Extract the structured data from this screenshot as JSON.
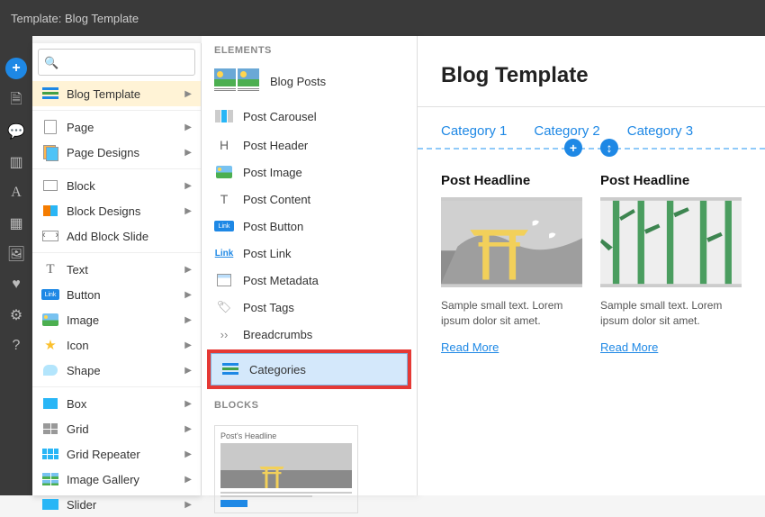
{
  "topbar": {
    "title": "Template: Blog Template"
  },
  "rail": {
    "plus": "+",
    "icons": [
      "file",
      "comment",
      "layout",
      "text",
      "grid",
      "image",
      "heart",
      "gear",
      "help"
    ]
  },
  "search": {
    "placeholder": ""
  },
  "panel1": {
    "active": {
      "label": "Blog Template"
    },
    "groups": [
      [
        {
          "label": "Page",
          "icon": "page"
        },
        {
          "label": "Page Designs",
          "icon": "pages"
        }
      ],
      [
        {
          "label": "Block",
          "icon": "block"
        },
        {
          "label": "Block Designs",
          "icon": "blockd"
        },
        {
          "label": "Add Block Slide",
          "icon": "slide"
        }
      ],
      [
        {
          "label": "Text",
          "icon": "text"
        },
        {
          "label": "Button",
          "icon": "btn"
        },
        {
          "label": "Image",
          "icon": "image"
        },
        {
          "label": "Icon",
          "icon": "star"
        },
        {
          "label": "Shape",
          "icon": "shape"
        }
      ],
      [
        {
          "label": "Box",
          "icon": "box"
        },
        {
          "label": "Grid",
          "icon": "grid"
        },
        {
          "label": "Grid Repeater",
          "icon": "gridr"
        },
        {
          "label": "Image Gallery",
          "icon": "gallery"
        },
        {
          "label": "Slider",
          "icon": "slider"
        }
      ]
    ]
  },
  "panel2": {
    "header_elements": "ELEMENTS",
    "header_blocks": "BLOCKS",
    "big": [
      {
        "label": "Blog Posts"
      },
      {
        "label": "Post Carousel"
      }
    ],
    "items": [
      {
        "label": "Post Header",
        "icon": "H"
      },
      {
        "label": "Post Image",
        "icon": "image"
      },
      {
        "label": "Post Content",
        "icon": "T"
      },
      {
        "label": "Post Button",
        "icon": "btn"
      },
      {
        "label": "Post Link",
        "icon": "link"
      },
      {
        "label": "Post Metadata",
        "icon": "cal"
      },
      {
        "label": "Post Tags",
        "icon": "tag"
      },
      {
        "label": "Breadcrumbs",
        "icon": "crumb"
      }
    ],
    "highlighted": {
      "label": "Categories"
    },
    "block_preview_title": "Post's Headline"
  },
  "canvas": {
    "title": "Blog Template",
    "categories": [
      "Category 1",
      "Category 2",
      "Category 3"
    ],
    "posts": [
      {
        "headline": "Post Headline",
        "text": "Sample small text. Lorem ipsum dolor sit amet.",
        "link": "Read More"
      },
      {
        "headline": "Post Headline",
        "text": "Sample small text. Lorem ipsum dolor sit amet.",
        "link": "Read More"
      }
    ]
  }
}
